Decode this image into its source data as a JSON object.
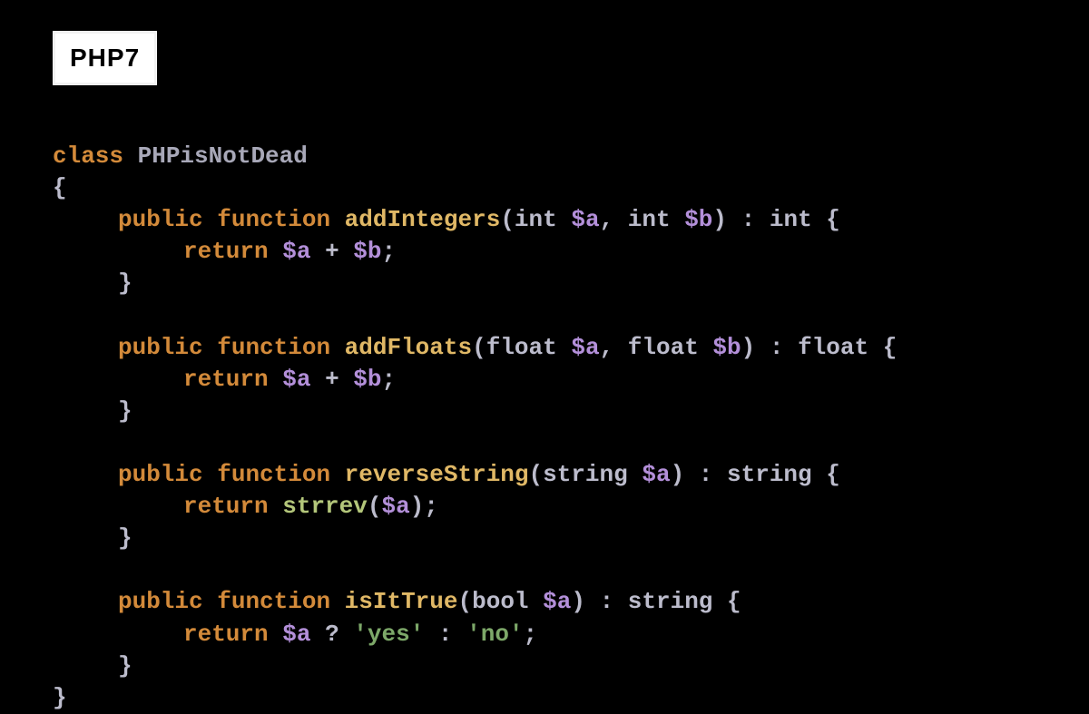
{
  "logo": {
    "text": "PHP7"
  },
  "code": {
    "kw_class": "class",
    "classname": "PHPisNotDead",
    "open_brace": "{",
    "close_brace": "}",
    "kw_public": "public",
    "kw_function": "function",
    "kw_return": "return",
    "fn1": {
      "name": "addIntegers",
      "p1_type": "int",
      "p1_var": "$a",
      "p2_type": "int",
      "p2_var": "$b",
      "ret_type": "int",
      "body_var_a": "$a",
      "body_op": "+",
      "body_var_b": "$b"
    },
    "fn2": {
      "name": "addFloats",
      "p1_type": "float",
      "p1_var": "$a",
      "p2_type": "float",
      "p2_var": "$b",
      "ret_type": "float",
      "body_var_a": "$a",
      "body_op": "+",
      "body_var_b": "$b"
    },
    "fn3": {
      "name": "reverseString",
      "p1_type": "string",
      "p1_var": "$a",
      "ret_type": "string",
      "call": "strrev",
      "call_arg": "$a"
    },
    "fn4": {
      "name": "isItTrue",
      "p1_type": "bool",
      "p1_var": "$a",
      "ret_type": "string",
      "body_var": "$a",
      "tern_q": "?",
      "str_yes": "'yes'",
      "tern_c": ":",
      "str_no": "'no'"
    },
    "punct": {
      "lparen": "(",
      "rparen": ")",
      "comma": ",",
      "colon": ":",
      "semicolon": ";",
      "open_brace": "{",
      "close_brace": "}"
    }
  }
}
